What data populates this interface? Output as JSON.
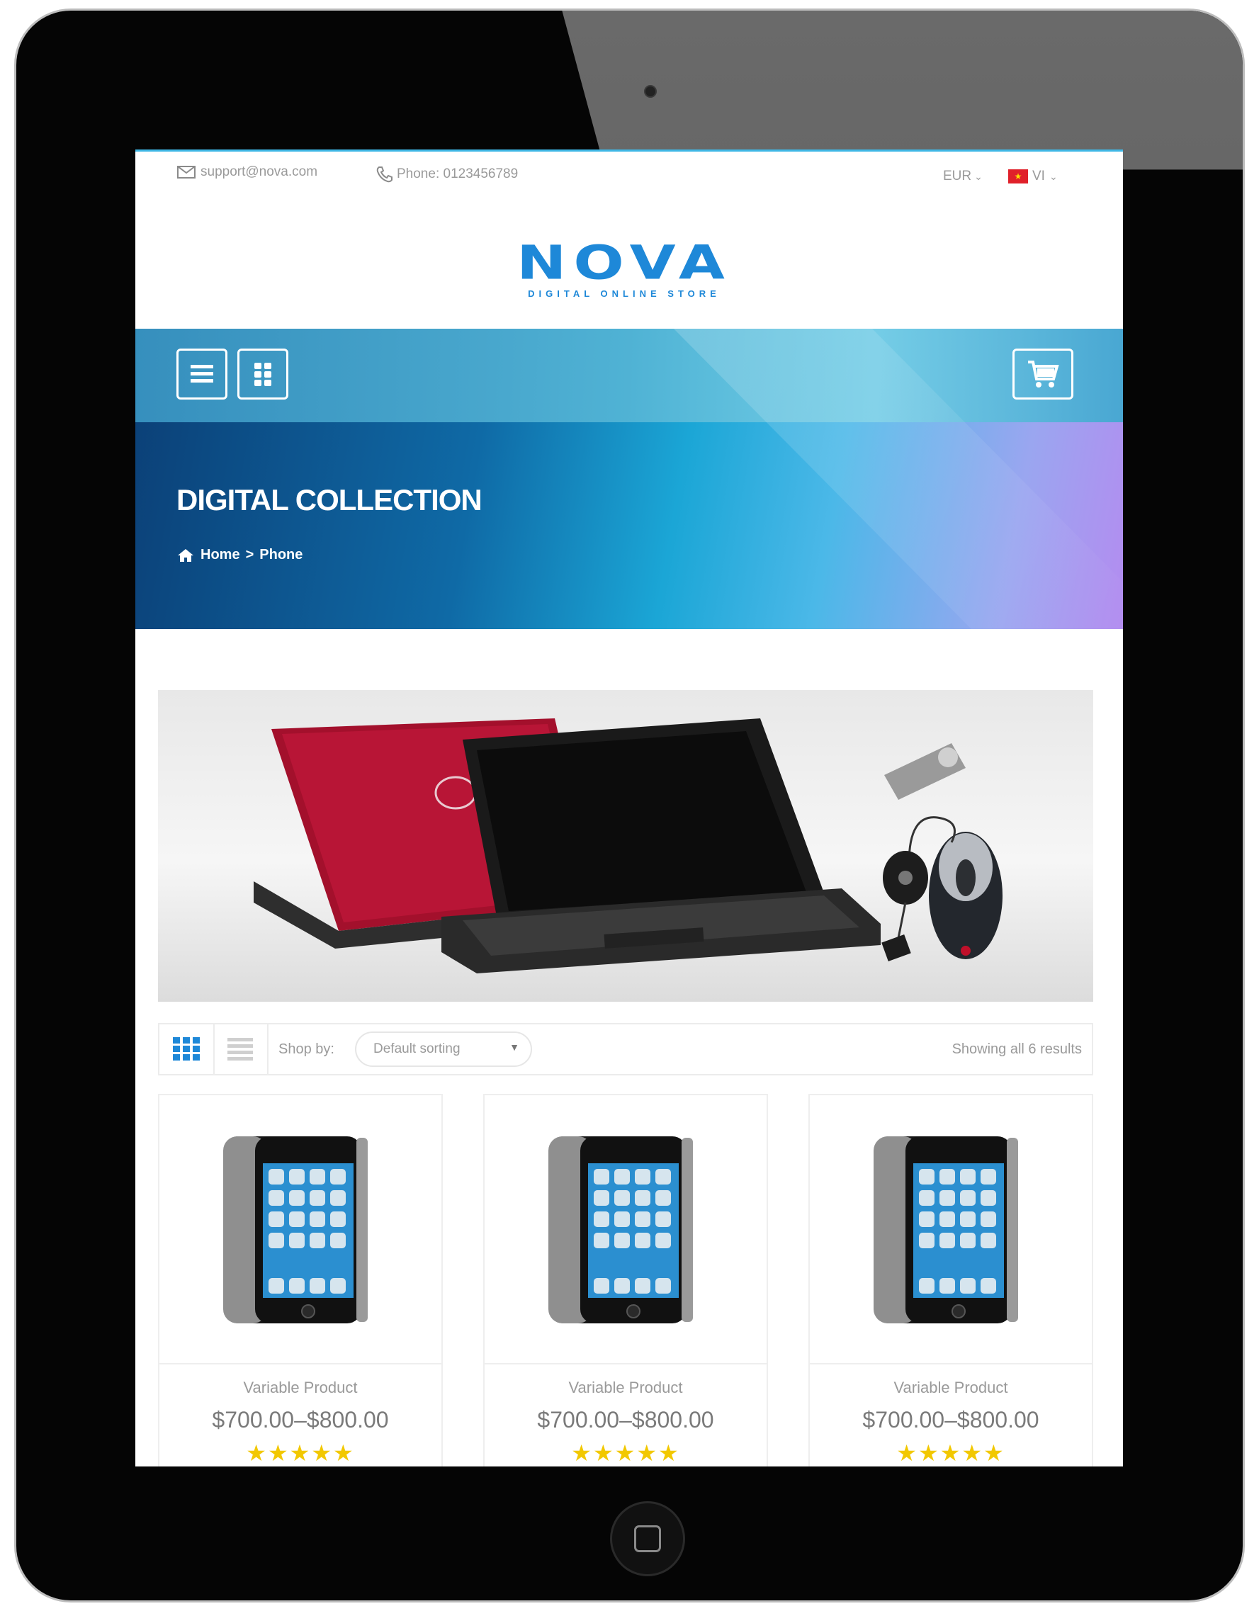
{
  "topbar": {
    "email": "support@nova.com",
    "phone": "Phone: 0123456789",
    "currency": "EUR",
    "language": "VI"
  },
  "logo": {
    "brand": "NOVA",
    "tagline": "DIGITAL ONLINE STORE"
  },
  "hero": {
    "title": "DIGITAL COLLECTION",
    "breadcrumb": {
      "home": "Home",
      "separator": ">",
      "current": "Phone"
    }
  },
  "shop_toolbar": {
    "shop_by_label": "Shop by:",
    "sort_selected": "Default sorting",
    "results_text": "Showing all 6 results"
  },
  "products": [
    {
      "name": "Variable Product",
      "price": "$700.00–$800.00",
      "rating": 5
    },
    {
      "name": "Variable Product",
      "price": "$700.00–$800.00",
      "rating": 5
    },
    {
      "name": "Variable Product",
      "price": "$700.00–$800.00",
      "rating": 5
    }
  ],
  "colors": {
    "accent": "#1e88d8",
    "star": "#f2c800",
    "hero_start": "#0b3f76",
    "hero_end": "#b38cf0"
  },
  "icons": {
    "email": "envelope-icon",
    "phone": "phone-icon",
    "menu": "hamburger-menu-icon",
    "apps": "grid-apps-icon",
    "cart": "shopping-cart-icon",
    "home": "home-icon",
    "grid_view": "grid-view-icon",
    "list_view": "list-view-icon"
  }
}
